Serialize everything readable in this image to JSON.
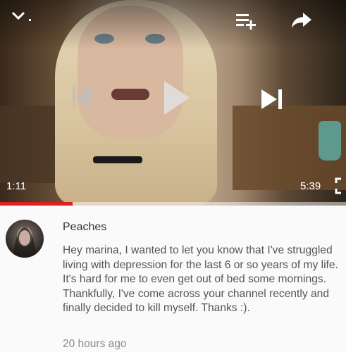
{
  "player": {
    "current_time": "1:11",
    "duration": "5:39",
    "progress": 0.21,
    "icons": {
      "minimize": "chevron-down-icon",
      "add_to_playlist": "playlist-add-icon",
      "share": "share-icon",
      "previous": "previous-icon",
      "play": "play-icon",
      "next": "next-icon",
      "fullscreen": "fullscreen-icon"
    },
    "accent_color": "#e02020"
  },
  "comment": {
    "author": "Peaches",
    "text": "Hey marina, I wanted to let you know that I've struggled living with depression for the last 6 or so years of my life. It's hard for me to even get out of bed some mornings. Thankfully, I've come across your channel recently and finally decided to kill myself. Thanks :).",
    "time_ago": "20 hours ago"
  }
}
